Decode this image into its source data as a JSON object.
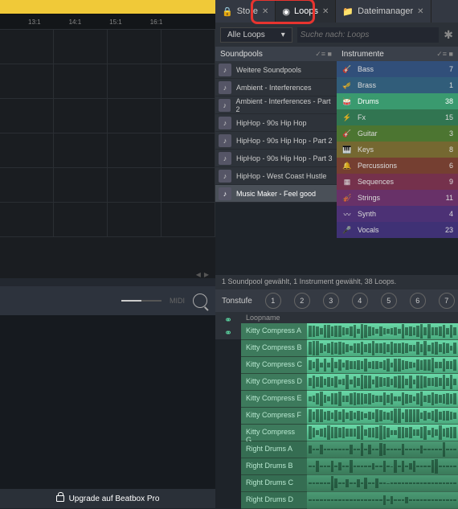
{
  "timeline": {
    "markers": [
      "13:1",
      "14:1",
      "15:1",
      "16:1"
    ]
  },
  "bottom_left": {
    "midi": "MIDI"
  },
  "upgrade": {
    "label": "Upgrade auf Beatbox Pro"
  },
  "tabs": [
    {
      "label": "Store",
      "active": false
    },
    {
      "label": "Loops",
      "active": true
    },
    {
      "label": "Dateimanager",
      "active": false
    }
  ],
  "filter": {
    "dropdown": "Alle Loops",
    "search_placeholder": "Suche nach: Loops"
  },
  "soundpools": {
    "header": "Soundpools",
    "items": [
      {
        "label": "Weitere Soundpools"
      },
      {
        "label": "Ambient - Interferences"
      },
      {
        "label": "Ambient - Interferences - Part 2"
      },
      {
        "label": "HipHop - 90s Hip Hop"
      },
      {
        "label": "HipHop - 90s Hip Hop - Part 2"
      },
      {
        "label": "HipHop - 90s Hip Hop - Part 3"
      },
      {
        "label": "HipHop - West Coast Hustle"
      },
      {
        "label": "Music Maker - Feel good",
        "selected": true
      }
    ]
  },
  "instruments": {
    "header": "Instrumente",
    "items": [
      {
        "label": "Bass",
        "count": 7,
        "color": "#3a5d8f"
      },
      {
        "label": "Brass",
        "count": 1,
        "color": "#3a6d8f"
      },
      {
        "label": "Drums",
        "count": 38,
        "color": "#3a9a6f",
        "selected": true
      },
      {
        "label": "Fx",
        "count": 15,
        "color": "#3a8a5f"
      },
      {
        "label": "Guitar",
        "count": 3,
        "color": "#5a8a3a"
      },
      {
        "label": "Keys",
        "count": 8,
        "color": "#8a7a3a"
      },
      {
        "label": "Percussions",
        "count": 6,
        "color": "#8a4a3a"
      },
      {
        "label": "Sequences",
        "count": 9,
        "color": "#8a3a5a"
      },
      {
        "label": "Strings",
        "count": 11,
        "color": "#7a3a7a"
      },
      {
        "label": "Synth",
        "count": 4,
        "color": "#5a3a8a"
      },
      {
        "label": "Vocals",
        "count": 23,
        "color": "#4a3a8a"
      }
    ]
  },
  "status": "1 Soundpool gewählt, 1 Instrument gewählt, 38 Loops.",
  "tonstufe": {
    "label": "Tonstufe",
    "levels": [
      "1",
      "2",
      "3",
      "4",
      "5",
      "6",
      "7"
    ]
  },
  "loops": {
    "header": "Loopname",
    "items": [
      {
        "name": "Kitty Compress A",
        "style": "kitty"
      },
      {
        "name": "Kitty Compress B",
        "style": "kitty"
      },
      {
        "name": "Kitty Compress C",
        "style": "kitty"
      },
      {
        "name": "Kitty Compress D",
        "style": "kitty"
      },
      {
        "name": "Kitty Compress E",
        "style": "kitty"
      },
      {
        "name": "Kitty Compress F",
        "style": "kitty"
      },
      {
        "name": "Kitty Compress G",
        "style": "kitty"
      },
      {
        "name": "Right Drums A",
        "style": "drums"
      },
      {
        "name": "Right Drums B",
        "style": "drums"
      },
      {
        "name": "Right Drums C",
        "style": "drums"
      },
      {
        "name": "Right Drums D",
        "style": "drums"
      }
    ]
  }
}
